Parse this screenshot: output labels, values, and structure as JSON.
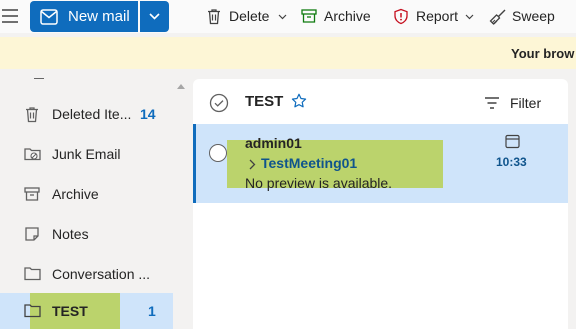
{
  "toolbar": {
    "new_mail_label": "New mail",
    "delete_label": "Delete",
    "archive_label": "Archive",
    "report_label": "Report",
    "sweep_label": "Sweep"
  },
  "banner": {
    "text": "Your brow"
  },
  "folders": [
    {
      "label": "Deleted Ite...",
      "count": "14",
      "icon": "trash-icon"
    },
    {
      "label": "Junk Email",
      "count": "",
      "icon": "junk-folder-icon"
    },
    {
      "label": "Archive",
      "count": "",
      "icon": "archive-icon"
    },
    {
      "label": "Notes",
      "count": "",
      "icon": "notes-icon"
    },
    {
      "label": "Conversation ...",
      "count": "",
      "icon": "folder-icon"
    },
    {
      "label": "TEST",
      "count": "1",
      "icon": "folder-icon",
      "selected": true
    }
  ],
  "message_list": {
    "title": "TEST",
    "filter_label": "Filter",
    "messages": [
      {
        "sender": "admin01",
        "subject": "TestMeeting01",
        "preview": "No preview is available.",
        "time": "10:33",
        "icon": "calendar-icon"
      }
    ]
  },
  "colors": {
    "accent": "#0f6cbd",
    "selection": "#cfe4fa",
    "highlight": "#b4cd3c",
    "banner": "#fdf6d6"
  }
}
